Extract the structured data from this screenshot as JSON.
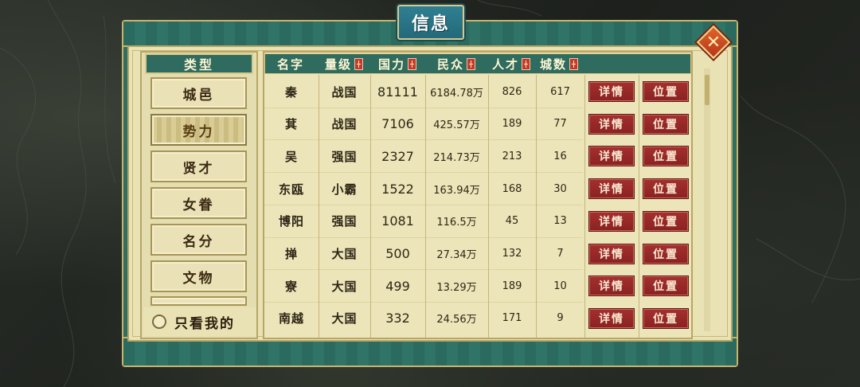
{
  "dialog": {
    "title": "信息",
    "close_label": "✕"
  },
  "sidebar": {
    "header": "类型",
    "items": [
      {
        "label": "城邑"
      },
      {
        "label": "势力"
      },
      {
        "label": "贤才"
      },
      {
        "label": "女眷"
      },
      {
        "label": "名分"
      },
      {
        "label": "文物"
      }
    ],
    "active_index": 1,
    "only_mine_label": "只看我的"
  },
  "table": {
    "headers": {
      "name": "名字",
      "rank": "量级",
      "power": "国力",
      "population": "民众",
      "talent": "人才",
      "cities": "城数"
    },
    "rows": [
      {
        "name": "秦",
        "rank": "战国",
        "power": "81111",
        "population": "6184.78万",
        "talent": "826",
        "cities": "617"
      },
      {
        "name": "萁",
        "rank": "战国",
        "power": "7106",
        "population": "425.57万",
        "talent": "189",
        "cities": "77"
      },
      {
        "name": "吴",
        "rank": "强国",
        "power": "2327",
        "population": "214.73万",
        "talent": "213",
        "cities": "16"
      },
      {
        "name": "东瓯",
        "rank": "小霸",
        "power": "1522",
        "population": "163.94万",
        "talent": "168",
        "cities": "30"
      },
      {
        "name": "博阳",
        "rank": "强国",
        "power": "1081",
        "population": "116.5万",
        "talent": "45",
        "cities": "13"
      },
      {
        "name": "掸",
        "rank": "大国",
        "power": "500",
        "population": "27.34万",
        "talent": "132",
        "cities": "7"
      },
      {
        "name": "寮",
        "rank": "大国",
        "power": "499",
        "population": "13.29万",
        "talent": "189",
        "cities": "10"
      },
      {
        "name": "南越",
        "rank": "大国",
        "power": "332",
        "population": "24.56万",
        "talent": "171",
        "cities": "9"
      }
    ],
    "detail_label": "详情",
    "location_label": "位置"
  }
}
